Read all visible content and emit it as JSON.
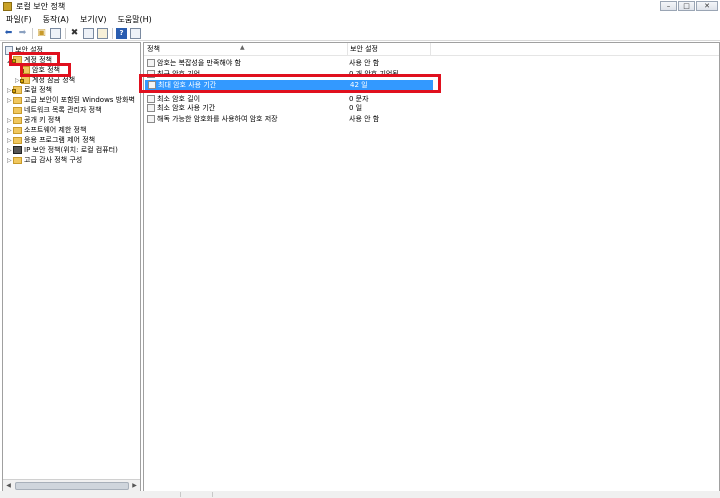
{
  "window": {
    "title": "로컬 보안 정책"
  },
  "menu": [
    "파일(F)",
    "동작(A)",
    "보기(V)",
    "도움말(H)"
  ],
  "toolbar": {
    "icons": [
      "back-arrow-icon",
      "forward-arrow-icon",
      "up-folder-icon",
      "show-hide-tree-icon",
      "delete-icon",
      "properties-icon",
      "export-icon",
      "help-icon",
      "console-icon"
    ]
  },
  "tree": {
    "root": "보안 설정",
    "items": [
      {
        "label": "계정 정책",
        "level": 1,
        "expanded": true
      },
      {
        "label": "암호 정책",
        "level": 2,
        "selected": true
      },
      {
        "label": "계정 잠금 정책",
        "level": 2
      },
      {
        "label": "로컬 정책",
        "level": 1
      },
      {
        "label": "고급 보안이 포함된 Windows 방화벽",
        "level": 1
      },
      {
        "label": "네트워크 목록 관리자 정책",
        "level": 1
      },
      {
        "label": "공개 키 정책",
        "level": 1
      },
      {
        "label": "소프트웨어 제한 정책",
        "level": 1
      },
      {
        "label": "응용 프로그램 제어 정책",
        "level": 1
      },
      {
        "label": "IP 보안 정책(위치: 로컬 컴퓨터)",
        "level": 1
      },
      {
        "label": "고급 감사 정책 구성",
        "level": 1
      }
    ]
  },
  "list": {
    "columns": [
      "정책",
      "보안 설정"
    ],
    "rows": [
      {
        "policy": "암호는 복잡성을 만족해야 함",
        "setting": "사용 안 함"
      },
      {
        "policy": "최근 암호 기억",
        "setting": "0 개 암호 기억됨"
      },
      {
        "policy": "최대 암호 사용 기간",
        "setting": "42 일",
        "selected": true
      },
      {
        "policy": "최소 암호 길이",
        "setting": "0 문자"
      },
      {
        "policy": "최소 암호 사용 기간",
        "setting": "0 일"
      },
      {
        "policy": "해독 가능한 암호화를 사용하여 암호 저장",
        "setting": "사용 안 함"
      }
    ]
  },
  "colors": {
    "selection": "#3399ff",
    "highlight_box": "#e0101e"
  }
}
